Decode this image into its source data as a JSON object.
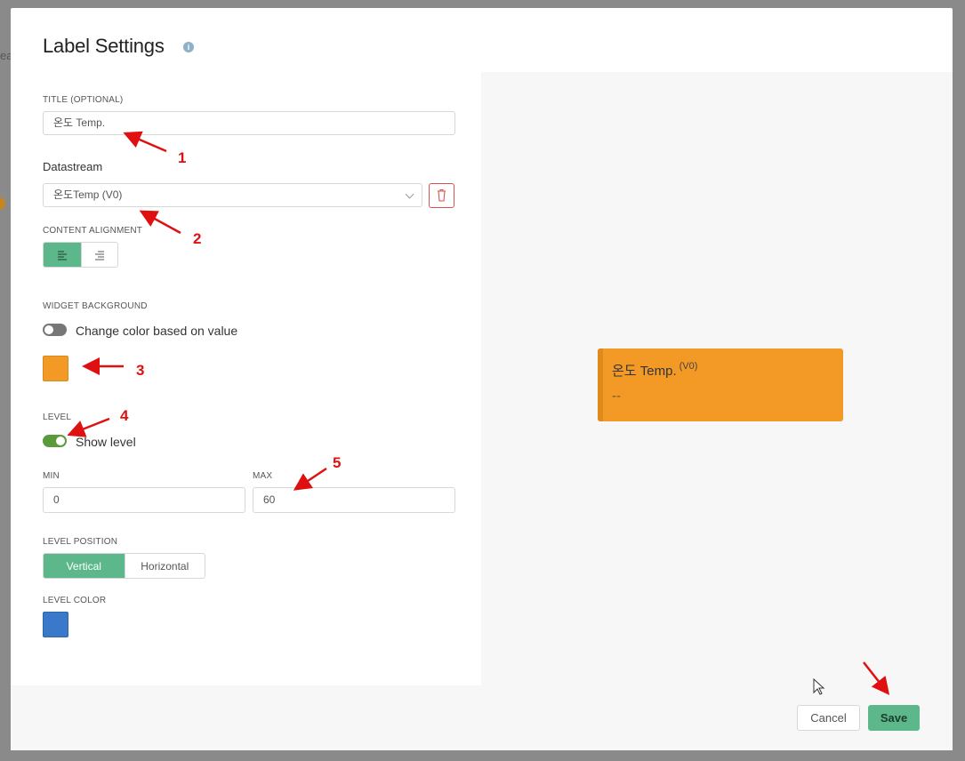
{
  "background": {
    "fragment_text": "ea"
  },
  "modal": {
    "title": "Label Settings",
    "info_icon": "info-icon",
    "title_field": {
      "label": "TITLE (OPTIONAL)",
      "value": "온도 Temp."
    },
    "datastream": {
      "label": "Datastream",
      "selected": "온도Temp (V0)",
      "delete_icon": "trash-icon"
    },
    "content_alignment": {
      "label": "CONTENT ALIGNMENT",
      "options": [
        "align-left-icon",
        "align-right-icon"
      ],
      "selected": "align-left-icon"
    },
    "widget_background": {
      "label": "WIDGET BACKGROUND",
      "toggle_label": "Change color based on value",
      "toggle_on": false,
      "color": "#f39a26"
    },
    "level": {
      "label": "LEVEL",
      "toggle_label": "Show level",
      "toggle_on": true,
      "min_label": "MIN",
      "min_value": "0",
      "max_label": "MAX",
      "max_value": "60"
    },
    "level_position": {
      "label": "LEVEL POSITION",
      "options": [
        "Vertical",
        "Horizontal"
      ],
      "selected": "Vertical"
    },
    "level_color": {
      "label": "LEVEL COLOR",
      "color": "#3a78c9"
    }
  },
  "preview": {
    "title": "온도 Temp.",
    "pin": "(V0)",
    "value": "--",
    "bg_color": "#f39a26",
    "level_color": "#e08a1b"
  },
  "footer": {
    "cancel_label": "Cancel",
    "save_label": "Save"
  },
  "annotations": [
    "1",
    "2",
    "3",
    "4",
    "5"
  ],
  "colors": {
    "accent": "#5cb88a",
    "annotation": "#e01010",
    "toggle_off": "#777777",
    "toggle_on": "#5a9a3a"
  }
}
